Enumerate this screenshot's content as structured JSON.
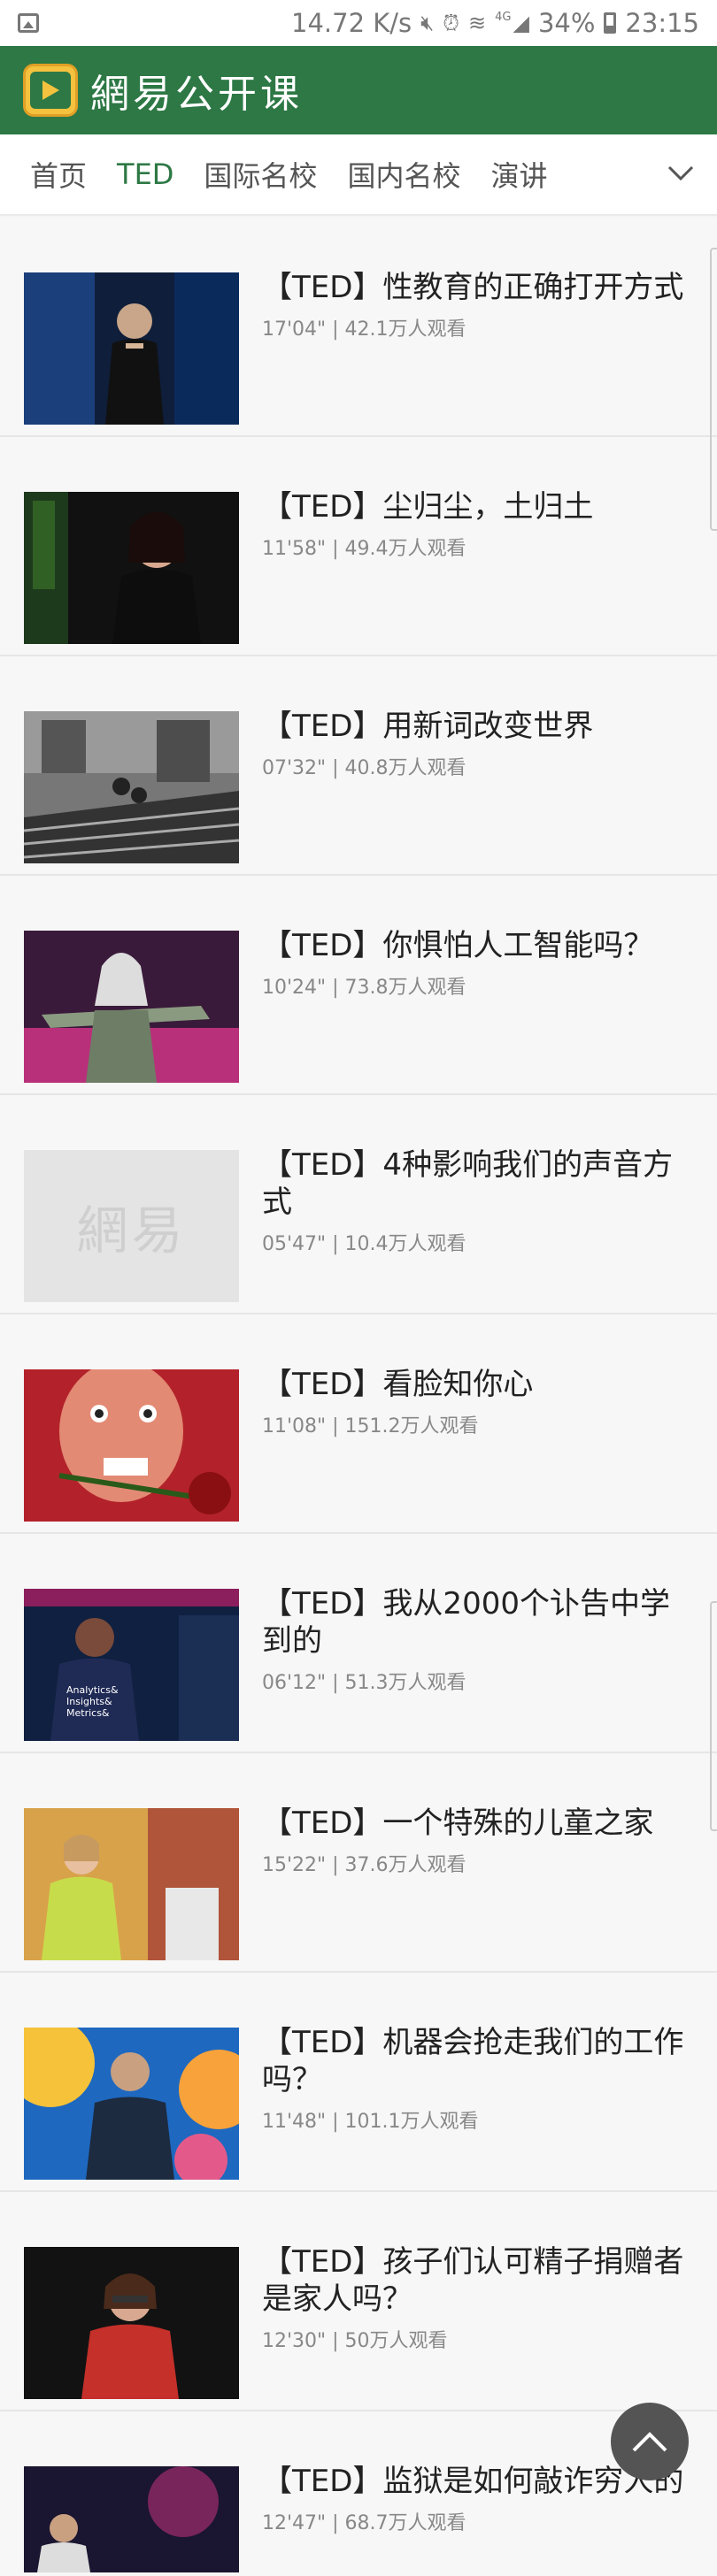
{
  "status_bar": {
    "speed": "14.72 K/s",
    "network": "4G",
    "battery": "34%",
    "time": "23:15",
    "icons": [
      "gallery-icon",
      "mute-icon",
      "alarm-icon",
      "wifi-icon",
      "signal-icon",
      "battery-icon"
    ]
  },
  "app": {
    "title": "網易公开课",
    "logo": "play-logo-icon",
    "accent": "#2d7845"
  },
  "tabs": [
    {
      "label": "首页"
    },
    {
      "label": "TED",
      "active": true
    },
    {
      "label": "国际名校"
    },
    {
      "label": "国内名校"
    },
    {
      "label": "演讲"
    }
  ],
  "tabs_more_icon": "chevron-down-icon",
  "list": [
    {
      "title": "【TED】性教育的正确打开方式",
      "meta": "17'04\" | 42.1万人观看"
    },
    {
      "title": "【TED】尘归尘，土归土",
      "meta": "11'58\" | 49.4万人观看"
    },
    {
      "title": "【TED】用新词改变世界",
      "meta": "07'32\" | 40.8万人观看"
    },
    {
      "title": "【TED】你惧怕人工智能吗？",
      "meta": "10'24\" | 73.8万人观看"
    },
    {
      "title": "【TED】4种影响我们的声音方式",
      "meta": "05'47\" | 10.4万人观看",
      "placeholder_text": "網易"
    },
    {
      "title": "【TED】看脸知你心",
      "meta": "11'08\" | 151.2万人观看"
    },
    {
      "title": "【TED】我从2000个讣告中学到的",
      "meta": "06'12\" | 51.3万人观看",
      "thumb_text": "Analytics& Insights& Metrics&"
    },
    {
      "title": "【TED】一个特殊的儿童之家",
      "meta": "15'22\" | 37.6万人观看"
    },
    {
      "title": "【TED】机器会抢走我们的工作吗？",
      "meta": "11'48\" | 101.1万人观看"
    },
    {
      "title": "【TED】孩子们认可精子捐赠者是家人吗？",
      "meta": "12'30\" | 50万人观看"
    },
    {
      "title": "【TED】监狱是如何敲诈穷人的",
      "meta": "12'47\" | 68.7万人观看"
    }
  ],
  "scroll_top_icon": "chevron-up-icon"
}
